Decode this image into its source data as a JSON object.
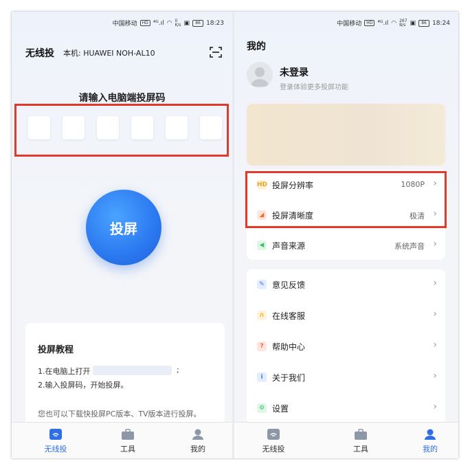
{
  "left": {
    "status": {
      "carrier": "中国移动",
      "speed": "0",
      "speed_unit": "K/s",
      "battery": "86",
      "time": "18:23"
    },
    "header": {
      "title": "无线投",
      "device_label": "本机:",
      "device_name": "HUAWEI NOH-AL10"
    },
    "code": {
      "prompt": "请输入电脑端投屏码",
      "digits": 6
    },
    "cast_button": "投屏",
    "tutorial": {
      "title": "投屏教程",
      "step1": "1.在电脑上打开",
      "step1_end": ";",
      "step2": "2.输入投屏码，开始投屏。",
      "note": "您也可以下载快投屏PC版本、TV版本进行投屏。"
    },
    "tabs": [
      {
        "label": "无线投",
        "icon": "cast-icon",
        "active": true
      },
      {
        "label": "工具",
        "icon": "toolbox-icon",
        "active": false
      },
      {
        "label": "我的",
        "icon": "user-icon",
        "active": false
      }
    ]
  },
  "right": {
    "status": {
      "carrier": "中国移动",
      "speed": "267",
      "speed_unit": "B/s",
      "battery": "86",
      "time": "18:24"
    },
    "header": {
      "title": "我的"
    },
    "profile": {
      "name": "未登录",
      "hint": "登录体验更多投屏功能"
    },
    "settings": [
      {
        "label": "投屏分辨率",
        "value": "1080P",
        "icon": "hd-icon",
        "color": "#f2a21b"
      },
      {
        "label": "投屏清晰度",
        "value": "极清",
        "icon": "clarity-icon",
        "color": "#f06a3a"
      },
      {
        "label": "声音来源",
        "value": "系统声音",
        "icon": "speaker-icon",
        "color": "#3cc26b"
      }
    ],
    "menu": [
      {
        "label": "意见反馈",
        "icon": "feedback-icon",
        "color": "#3a7bf0"
      },
      {
        "label": "在线客服",
        "icon": "headset-icon",
        "color": "#f2b21b"
      },
      {
        "label": "帮助中心",
        "icon": "help-icon",
        "color": "#f06a3a"
      },
      {
        "label": "关于我们",
        "icon": "info-icon",
        "color": "#3a7bf0"
      },
      {
        "label": "设置",
        "icon": "gear-icon",
        "color": "#3cc26b"
      }
    ],
    "tabs": [
      {
        "label": "无线投",
        "icon": "cast-icon",
        "active": false
      },
      {
        "label": "工具",
        "icon": "toolbox-icon",
        "active": false
      },
      {
        "label": "我的",
        "icon": "user-icon",
        "active": true
      }
    ]
  },
  "accent": "#2f6fe6",
  "highlight": "#e13a2b"
}
